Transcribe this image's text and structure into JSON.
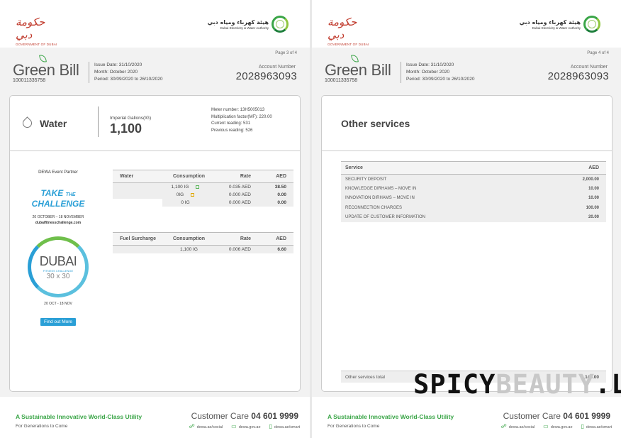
{
  "logos": {
    "gov_script": "حكومة دبي",
    "gov_text": "GOVERNMENT OF DUBAI",
    "dewa_ar": "هيئة كهرباء ومياه دبي",
    "dewa_en": "Dubai Electricity & Water Authority"
  },
  "header": {
    "brand": "Green Bill",
    "contract_no": "100011335758",
    "issue_date": "Issue Date: 31/10/2020",
    "month": "Month: October 2020",
    "period_prefix": "Period: 30/09/2020",
    "period_to": "to",
    "period_end": "26/10/2020",
    "account_label": "Account Number",
    "account_number": "2028963093"
  },
  "page_left": {
    "page_no": "Page 3 of 4",
    "section_title": "Water",
    "ig_label": "Imperial Gallons(IG)",
    "ig_value": "1,100",
    "meter": [
      "Meter number: 13H5005013",
      "Multiplication factor(MF): 220.00",
      "Current reading: 531",
      "Previous reading: 526"
    ],
    "water_table": {
      "headers": [
        "Water",
        "Consumption",
        "Rate",
        "AED"
      ],
      "rows": [
        {
          "consumption": "1,100 IG",
          "indicator": "green",
          "rate": "0.035 AED",
          "aed": "38.50"
        },
        {
          "consumption": "0IG",
          "indicator": "amber",
          "rate": "0.000 AED",
          "aed": "0.00"
        },
        {
          "consumption": "0 IG",
          "indicator": "",
          "rate": "0.000 AED",
          "aed": "0.00"
        }
      ]
    },
    "fuel_table": {
      "headers": [
        "Fuel Surcharge",
        "Consumption",
        "Rate",
        "AED"
      ],
      "rows": [
        {
          "consumption": "1,100 IG",
          "rate": "0.006 AED",
          "aed": "6.60"
        }
      ]
    },
    "promo": {
      "partner": "DEWA Event Partner",
      "take": "TAKE",
      "the": "THE",
      "challenge": "CHALLENGE",
      "dates": "20 OCTOBER – 18 NOVEMBER",
      "url": "dubaifitnesschallenge.com",
      "fc_dubai": "DUBAI",
      "fc_sub": "FITNESS CHALLENGE",
      "fc_30": "30 x 30",
      "fc_dates": "20 OCT - 18 NOV",
      "button": "Find out More"
    }
  },
  "page_right": {
    "page_no": "Page 4 of 4",
    "section_title": "Other services",
    "services_table": {
      "headers": [
        "Service",
        "AED"
      ],
      "rows": [
        {
          "service": "SECURITY DEPOSIT",
          "aed": "2,000.00"
        },
        {
          "service": "KNOWLEDGE DIRHAMS – MOVE IN",
          "aed": "10.00"
        },
        {
          "service": "INNOVATION DIRHAMS – MOVE IN",
          "aed": "10.00"
        },
        {
          "service": "RECONNECTION CHARGES",
          "aed": "100.00"
        },
        {
          "service": "UPDATE OF CUSTOMER INFORMATION",
          "aed": "20.00"
        }
      ]
    },
    "total_label": "Other services total",
    "total_value": "2,140.00"
  },
  "footer": {
    "tagline": "A Sustainable Innovative World-Class Utility",
    "tagline_sub": "For Generations to Come",
    "cc_label": "Customer Care",
    "cc_number": "04 601 9999",
    "links": [
      "dewa.ae/social",
      "dewa.gov.ae",
      "dewa.ae/smart"
    ]
  },
  "watermark": {
    "part1": "SPICY",
    "part2": "BEAUTY",
    "part3": ".LT"
  }
}
